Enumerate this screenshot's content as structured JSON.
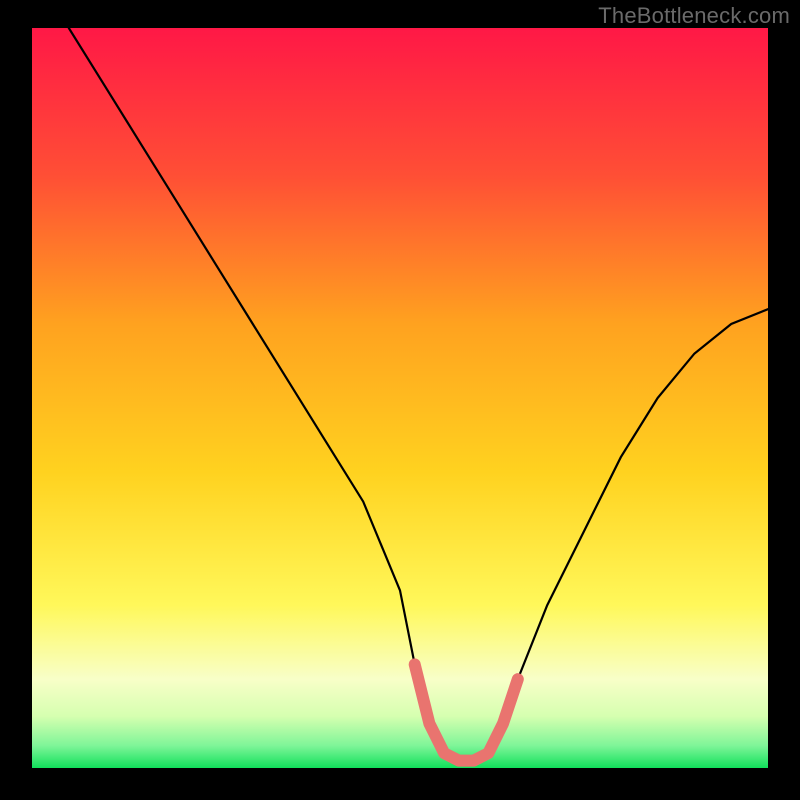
{
  "watermark": "TheBottleneck.com",
  "chart_data": {
    "type": "line",
    "title": "",
    "xlabel": "",
    "ylabel": "",
    "xlim": [
      0,
      100
    ],
    "ylim": [
      0,
      100
    ],
    "grid": false,
    "legend": false,
    "gradient_colors": {
      "top": "#ff1846",
      "mid_upper": "#ff7a2a",
      "mid": "#ffd21f",
      "mid_lower": "#fff85a",
      "band": "#f6ffd0",
      "bottom": "#11e05b"
    },
    "series": [
      {
        "name": "curve",
        "color": "#000000",
        "x": [
          5,
          10,
          15,
          20,
          25,
          30,
          35,
          40,
          45,
          50,
          52,
          54,
          56,
          58,
          60,
          62,
          64,
          66,
          70,
          75,
          80,
          85,
          90,
          95,
          100
        ],
        "y": [
          100,
          92,
          84,
          76,
          68,
          60,
          52,
          44,
          36,
          24,
          14,
          6,
          2,
          1,
          1,
          2,
          6,
          12,
          22,
          32,
          42,
          50,
          56,
          60,
          62
        ]
      },
      {
        "name": "highlight-band",
        "color": "#e9746f",
        "x": [
          52,
          54,
          56,
          58,
          60,
          62,
          64,
          66
        ],
        "y": [
          14,
          6,
          2,
          1,
          1,
          2,
          6,
          12
        ]
      }
    ],
    "highlight_x_range": [
      52,
      66
    ]
  }
}
